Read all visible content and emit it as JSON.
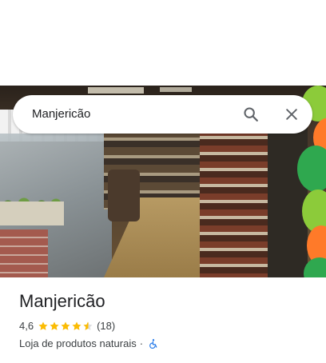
{
  "search": {
    "value": "Manjericão"
  },
  "place": {
    "name": "Manjericão",
    "rating": "4,6",
    "rating_value": 4.6,
    "review_count": "(18)",
    "category": "Loja de produtos naturais",
    "separator": "·"
  },
  "icons": {
    "search": "search-icon",
    "close": "close-icon",
    "star": "star-icon",
    "wheelchair": "wheelchair-accessible-icon"
  },
  "colors": {
    "star": "#fbbc04",
    "accessibility": "#1a73e8",
    "text_primary": "#202124",
    "text_secondary": "#3c4043"
  }
}
